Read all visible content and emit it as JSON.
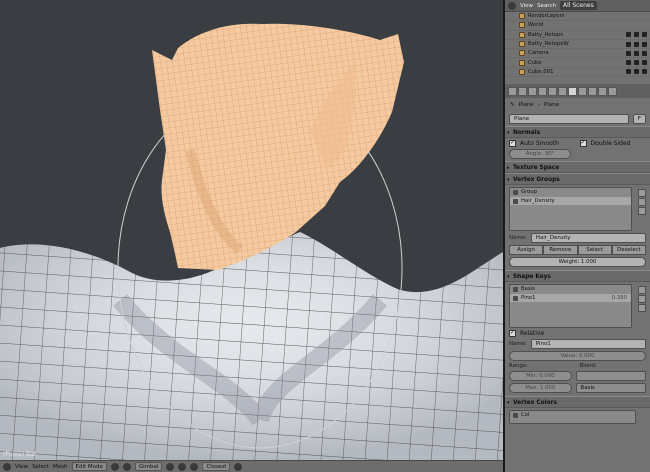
{
  "viewport": {
    "label": "(Pino1) Bat",
    "header": {
      "menus": [
        "View",
        "Select",
        "Mesh"
      ],
      "mode": "Edit Mode",
      "orientation": "Gimbal",
      "snap": "Closest"
    }
  },
  "outliner": {
    "menus": [
      "View",
      "Search"
    ],
    "scene_select": "All Scenes",
    "items": [
      "RenderLayers",
      "World",
      "Batty_Retops",
      "Batty_RetopeW",
      "Camera",
      "Cube",
      "Cube.001"
    ]
  },
  "properties": {
    "breadcrumb": [
      "Plane",
      "Plane"
    ],
    "datablock_name": "Plane",
    "datablock_users": "F",
    "normals": {
      "title": "Normals",
      "auto_smooth_label": "Auto Smooth",
      "auto_smooth": true,
      "double_sided_label": "Double Sided",
      "double_sided": true,
      "angle": "Angle: 30°"
    },
    "texture_space": {
      "title": "Texture Space"
    },
    "vertex_groups": {
      "title": "Vertex Groups",
      "items": [
        "Group",
        "Hair_Density"
      ],
      "name_label": "Name:",
      "name_value": "Hair_Density",
      "buttons": [
        "Assign",
        "Remove",
        "Select",
        "Deselect"
      ],
      "weight": "Weight: 1.000"
    },
    "shape_keys": {
      "title": "Shape Keys",
      "items": [
        "Basis",
        "Pino1"
      ],
      "pino_value": "0.380",
      "relative_label": "Relative",
      "name_label": "Name:",
      "name_value": "Pino1",
      "value": "Value: 0.000",
      "range_label": "Range:",
      "blend_label": "Blend:",
      "min": "Min: 0.000",
      "max": "Max: 1.000",
      "blend_value": "Basis"
    },
    "vertex_colors": {
      "title": "Vertex Colors",
      "item": "Col"
    }
  },
  "colors": {
    "viewport_bg": "#3a3d41",
    "head_wire": "#f2c79b",
    "body_wire": "#d9dde3",
    "panel_bg": "#727272"
  }
}
